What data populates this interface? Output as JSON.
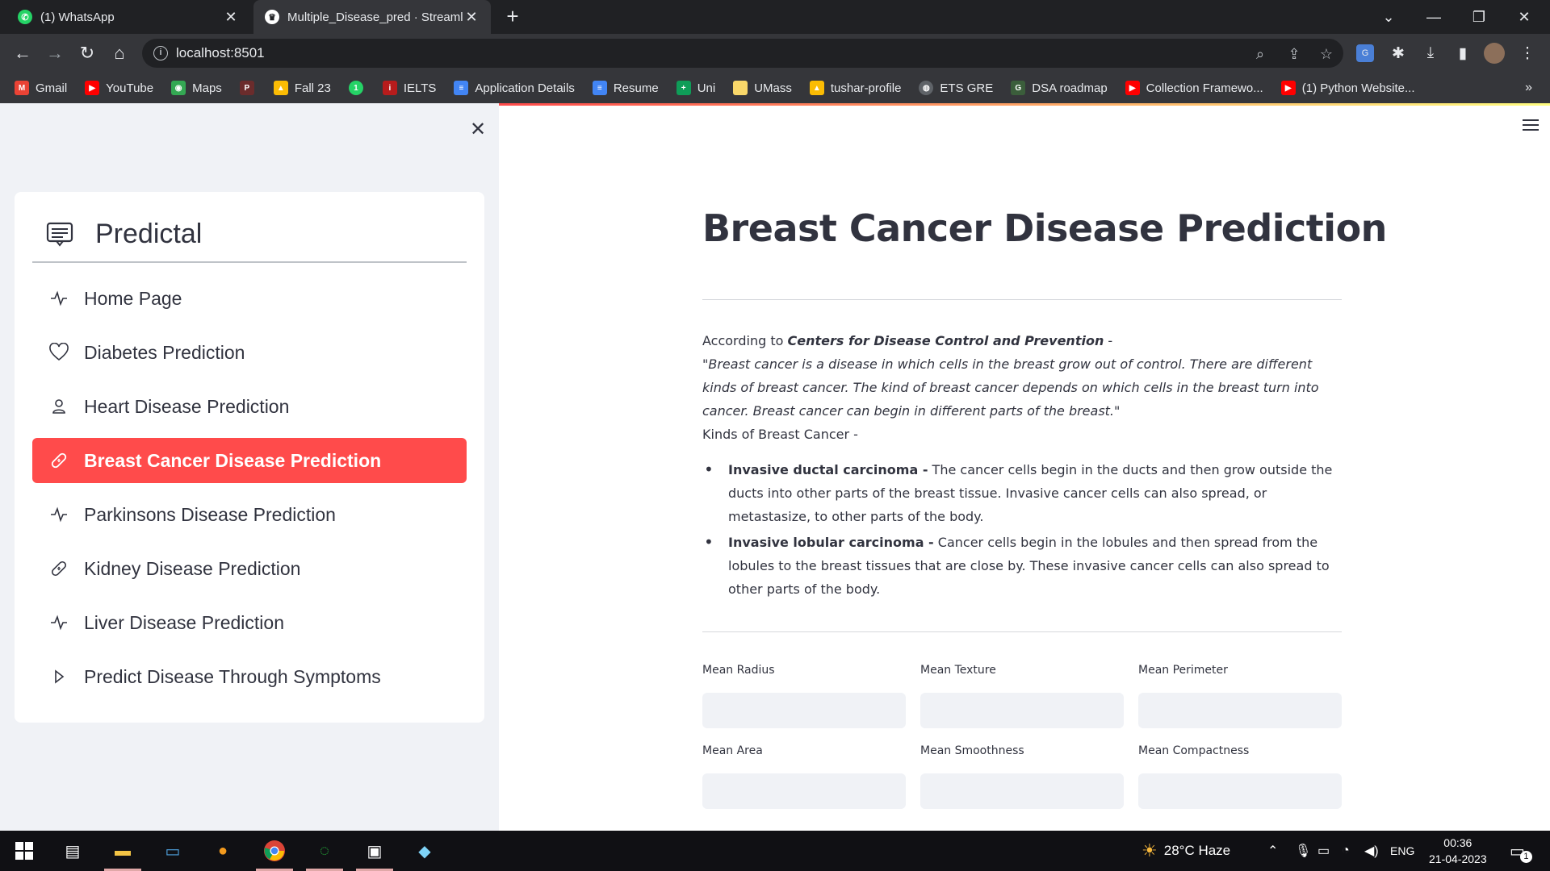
{
  "browser": {
    "tabs": [
      {
        "title": "(1) WhatsApp",
        "favicon": "whatsapp-icon"
      },
      {
        "title": "Multiple_Disease_pred · Streamlit",
        "favicon": "streamlit-icon"
      }
    ],
    "url": "localhost:8501",
    "bookmarks": [
      "Gmail",
      "YouTube",
      "Maps",
      "",
      "Fall 23",
      "",
      "IELTS",
      "Application Details",
      "Resume",
      "Uni",
      "UMass",
      "tushar-profile",
      "ETS GRE",
      "DSA roadmap",
      "Collection Framewo...",
      "(1) Python Website..."
    ]
  },
  "sidebar": {
    "title": "Predictal",
    "items": [
      {
        "label": "Home Page",
        "icon": "activity-icon"
      },
      {
        "label": "Diabetes Prediction",
        "icon": "heart-icon"
      },
      {
        "label": "Heart Disease Prediction",
        "icon": "person-icon"
      },
      {
        "label": "Breast Cancer Disease Prediction",
        "icon": "bandaid-icon",
        "selected": true
      },
      {
        "label": "Parkinsons Disease Prediction",
        "icon": "activity-icon"
      },
      {
        "label": "Kidney Disease Prediction",
        "icon": "bandaid-icon"
      },
      {
        "label": "Liver Disease Prediction",
        "icon": "activity-icon"
      },
      {
        "label": "Predict Disease Through Symptoms",
        "icon": "play-icon"
      }
    ]
  },
  "main": {
    "title": "Breast Cancer Disease Prediction",
    "intro_prefix": "According to ",
    "intro_source": "Centers for Disease Control and Prevention",
    "intro_suffix": " -",
    "quote": "\"Breast cancer is a disease in which cells in the breast grow out of control. There are different kinds of breast cancer. The kind of breast cancer depends on which cells in the breast turn into cancer. Breast cancer can begin in different parts of the breast.\"",
    "kinds_label": "Kinds of Breast Cancer -",
    "kinds": [
      {
        "name": "Invasive ductal carcinoma -",
        "text": " The cancer cells begin in the ducts and then grow outside the ducts into other parts of the breast tissue. Invasive cancer cells can also spread, or metastasize, to other parts of the body."
      },
      {
        "name": "Invasive lobular carcinoma -",
        "text": " Cancer cells begin in the lobules and then spread from the lobules to the breast tissues that are close by. These invasive cancer cells can also spread to other parts of the body."
      }
    ],
    "fields": [
      "Mean Radius",
      "Mean Texture",
      "Mean Perimeter",
      "Mean Area",
      "Mean Smoothness",
      "Mean Compactness"
    ],
    "accent_color": "#ff4b4b"
  },
  "taskbar": {
    "weather": "28°C  Haze",
    "language": "ENG",
    "time": "00:36",
    "date": "21-04-2023",
    "notification_count": "1"
  }
}
